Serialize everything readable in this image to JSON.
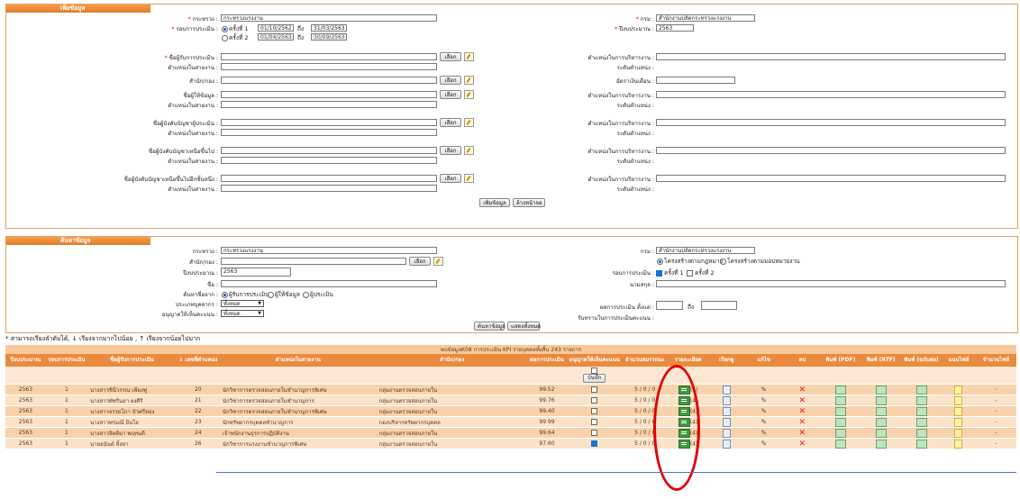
{
  "add_section": {
    "tab_label": "เพิ่มข้อมูล",
    "ministry_label": "กระทรวง :",
    "ministry_value": "กระทรวงแรงงาน",
    "department_label": "กรม :",
    "department_value": "สำนักงานปลัดกระทรวงแรงงาน",
    "round_label": "รอบการประเมิน :",
    "round1_label": "ครั้งที่ 1",
    "round1_from": "01/10/2562",
    "to_label": "ถึง",
    "round1_to": "31/03/2563",
    "round2_label": "ครั้งที่ 2",
    "round2_from": "01/04/2563",
    "round2_to": "30/09/2563",
    "budget_year_label": "ปีงบประมาณ :",
    "budget_year_value": "2563",
    "person_rows": [
      {
        "name_label": "ชื่อผู้รับการประเมิน :",
        "required": true,
        "pos_label": "ตำแหน่งในสายงาน :",
        "mgmt_label": "ตำแหน่งในการบริหารงาน :",
        "level_label": "ระดับตำแหน่ง :"
      },
      {
        "name_label": "ชื่อผู้ให้ข้อมูล :",
        "required": false,
        "pos_label": "ตำแหน่งในสายงาน :",
        "mgmt_label": "ตำแหน่งในการบริหารงาน :",
        "level_label": "ระดับตำแหน่ง :"
      },
      {
        "name_label": "ชื่อผู้บังคับบัญชาผู้ประเมิน :",
        "required": false,
        "pos_label": "ตำแหน่งในสายงาน :",
        "mgmt_label": "ตำแหน่งในการบริหารงาน :",
        "level_label": "ระดับตำแหน่ง :"
      },
      {
        "name_label": "ชื่อผู้บังคับบัญชาเหนือขึ้นไป :",
        "required": false,
        "pos_label": "ตำแหน่งในสายงาน :",
        "mgmt_label": "ตำแหน่งในการบริหารงาน :",
        "level_label": "ระดับตำแหน่ง :"
      },
      {
        "name_label": "ชื่อผู้บังคับบัญชาเหนือขึ้นไปอีกชั้นหนึ่ง :",
        "required": false,
        "pos_label": "ตำแหน่งในสายงาน :",
        "mgmt_label": "ตำแหน่งในการบริหารงาน :",
        "level_label": "ระดับตำแหน่ง :"
      }
    ],
    "office_label": "สำนัก/กอง :",
    "salary_label": "อัตราเงินเดือน :",
    "select_button": "เลือก",
    "add_button": "เพิ่มข้อมูล",
    "clear_button": "ล้างหน้าจอ"
  },
  "search_section": {
    "tab_label": "ค้นหาข้อมูล",
    "ministry_label": "กระทรวง :",
    "ministry_value": "กระทรวงแรงงาน",
    "department_label": "กรม :",
    "department_value": "สำนักงานปลัดกระทรวงแรงงาน",
    "office_label": "สำนัก/กอง :",
    "structure_law": "โครงสร้างตามกฎหมาย",
    "structure_assign": "โครงสร้างตามมอบหมายงาน",
    "budget_year_label": "ปีงบประมาณ :",
    "budget_year_value": "2563",
    "round_label": "รอบการประเมิน :",
    "round1_label": "ครั้งที่ 1",
    "round2_label": "ครั้งที่ 2",
    "firstname_label": "ชื่อ :",
    "lastname_label": "นามสกุล :",
    "search_by_label": "ค้นหาชื่อจาก :",
    "search_by_opts": [
      "ผู้รับการประเมิน",
      "ผู้ให้ข้อมูล",
      "ผู้ประเมิน"
    ],
    "personnel_type_label": "ประเภทบุคลากร :",
    "personnel_type_value": "ทั้งหมด",
    "approve_label": "อนุญาตให้เห็นคะแนน :",
    "approve_value": "ทั้งหมด",
    "score_from_label": "ผลการประเมิน ตั้งแต่ :",
    "score_to_label": "ถึง",
    "ack_label": "รับทราบในการประเมินคะแนน :",
    "select_button": "เลือก",
    "search_button": "ค้นหาข้อมูล",
    "show_all_button": "แสดงทั้งหมด"
  },
  "sort_note": "* สามารถเรียงลำดับได้, ↓ เรียงจากมากไปน้อย , ↑ เรียงจากน้อยไปมาก",
  "table": {
    "caption": "พบข้อมูลK08 การประเมิน KPI รายบุคคลทั้งสิ้น 243 รายการ",
    "headers": [
      "ปีงบประมาณ",
      "รอบการประเมิน",
      "ชื่อผู้รับการประเมิน",
      "↓ เลขที่ตำแหน่ง",
      "ตำแหน่งในสายงาน",
      "สำนัก/กอง",
      "ผลการประเมิน",
      "อนุญาตให้เห็นคะแนน",
      "จำนวนสมรรถนะ",
      "รายละเอียด",
      "เรียกดู",
      "แก้ไข",
      "ลบ",
      "พิมพ์ (PDF)",
      "พิมพ์ (RTF)",
      "พิมพ์ (ฉบับย่อ)",
      "แนบไฟล์",
      "จำนวนไฟล์"
    ],
    "save_label": "บันทึก",
    "rows": [
      {
        "year": "2563",
        "round": "1",
        "name": "นางสาวชินีวรรณ เพียงฟู",
        "posno": "20",
        "position": "นักวิชาการตรวจสอบภายในชำนาญการพิเศษ",
        "office": "กลุ่มงานตรวจสอบภายใน",
        "score": "99.52",
        "approved": false,
        "count": "5 / 0 / 0",
        "detail_count": "(4)",
        "files": "-"
      },
      {
        "year": "2563",
        "round": "1",
        "name": "นางสาวพัชรินยา ผงศิริ",
        "posno": "21",
        "position": "นักวิชาการตรวจสอบภายในชำนาญการ",
        "office": "กลุ่มงานตรวจสอบภายใน",
        "score": "99.76",
        "approved": false,
        "count": "5 / 0 / 0",
        "detail_count": "(4)",
        "files": "-"
      },
      {
        "year": "2563",
        "round": "1",
        "name": "นางสาวจรรยโภา ปัวศรีทอง",
        "posno": "22",
        "position": "นักวิชาการตรวจสอบภายในชำนาญการพิเศษ",
        "office": "กลุ่มงานตรวจสอบภายใน",
        "score": "99.40",
        "approved": false,
        "count": "5 / 0 / 0",
        "detail_count": "(4)",
        "files": "-"
      },
      {
        "year": "2563",
        "round": "1",
        "name": "นางสาวพรมณี ยีนโย",
        "posno": "23",
        "position": "นักทรัพยากรบุคคลชำนาญการ",
        "office": "กองบริหารทรัพยากรบุคคล",
        "score": "99.99",
        "approved": false,
        "count": "5 / 0 / 0",
        "detail_count": "(4)",
        "files": "-"
      },
      {
        "year": "2563",
        "round": "1",
        "name": "นางสาวจิตติมา พฤทนดี",
        "posno": "24",
        "position": "เจ้าพนักงานธุรการปฏิบัติงาน",
        "office": "กลุ่มงานตรวจสอบภายใน",
        "score": "99.64",
        "approved": false,
        "count": "5 / 0 / 0",
        "detail_count": "(4)",
        "files": "-"
      },
      {
        "year": "2563",
        "round": "1",
        "name": "นายอนันต์ ลิ้งหา",
        "posno": "26",
        "position": "นักวิชาการแรงงานชำนาญการพิเศษ",
        "office": "กลุ่มงานตรวจสอบภายใน",
        "score": "97.60",
        "approved": true,
        "count": "5 / 0 / 0",
        "detail_count": "(4)",
        "files": "-"
      }
    ]
  },
  "colors": {
    "accent": "#ea8a3e",
    "highlight_circle": "#e00000"
  }
}
